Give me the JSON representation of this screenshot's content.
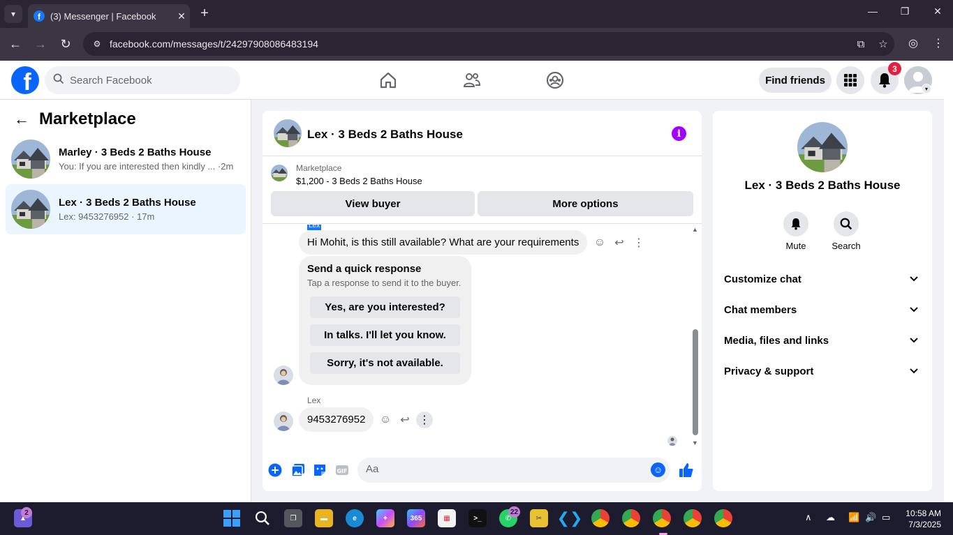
{
  "browser": {
    "tab_title": "(3) Messenger | Facebook",
    "url": "facebook.com/messages/t/24297908086483194"
  },
  "fb_header": {
    "search_placeholder": "Search Facebook",
    "find_friends_label": "Find friends",
    "notification_count": "3"
  },
  "left_panel": {
    "title": "Marketplace",
    "conversations": [
      {
        "name": "Marley · 3 Beds 2 Baths House",
        "snippet": "You: If you are interested then kindly ... ·2m",
        "active": false
      },
      {
        "name": "Lex · 3 Beds 2 Baths House",
        "snippet": "Lex: 9453276952 · 17m",
        "active": true
      }
    ]
  },
  "chat": {
    "title": "Lex · 3 Beds 2 Baths House",
    "listing": {
      "source": "Marketplace",
      "title": "$1,200 - 3 Beds 2 Baths House",
      "view_buyer_label": "View buyer",
      "more_options_label": "More options"
    },
    "partial_sender_tag": "Lex",
    "messages": [
      {
        "text": "Hi Mohit, is this still available? What are your requirements"
      }
    ],
    "quick_response": {
      "title": "Send a quick response",
      "subtitle": "Tap a response to send it to the buyer.",
      "options": [
        "Yes, are you interested?",
        "In talks. I'll let you know.",
        "Sorry, it's not available."
      ]
    },
    "last_sender": "Lex",
    "last_message": "9453276952",
    "composer_placeholder": "Aa"
  },
  "right_panel": {
    "name": "Lex · 3 Beds 2 Baths House",
    "actions": [
      {
        "label": "Mute",
        "icon": "bell-icon"
      },
      {
        "label": "Search",
        "icon": "search-icon"
      }
    ],
    "sections": [
      "Customize chat",
      "Chat members",
      "Media, files and links",
      "Privacy & support"
    ]
  },
  "taskbar": {
    "start_badge": "2",
    "whatsapp_badge": "22",
    "time": "10:58 AM",
    "date": "7/3/2025"
  },
  "colors": {
    "facebook_blue": "#0866ff",
    "active_conversation_bg": "#ebf5ff",
    "info_purple": "#a100ff",
    "notification_red": "#e41e3f"
  }
}
